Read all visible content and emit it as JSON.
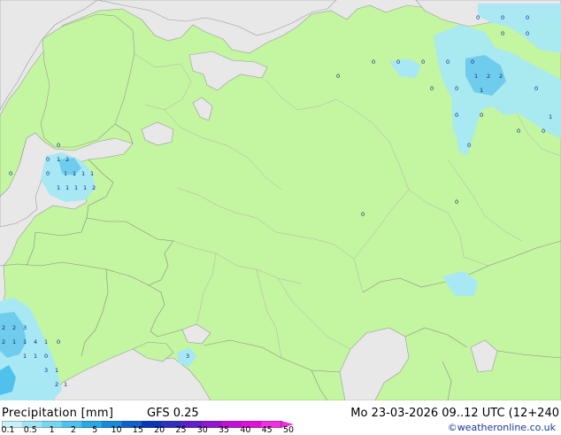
{
  "legend": {
    "title": "Precipitation [mm]",
    "model": "GFS 0.25",
    "valid_time": "Mo 23-03-2026 09..12 UTC (12+240",
    "credit": "©weatheronline.co.uk",
    "scale_labels": [
      "0.1",
      "0.5",
      "1",
      "2",
      "5",
      "10",
      "15",
      "20",
      "25",
      "30",
      "35",
      "40",
      "45",
      "50"
    ],
    "scale_colors": [
      "#c8f0f8",
      "#a0e4f4",
      "#78d4f0",
      "#50c0ec",
      "#28a8e4",
      "#1888d8",
      "#1060c8",
      "#0838b8",
      "#3030c0",
      "#6020c8",
      "#9018d0",
      "#c010d8",
      "#e010d8",
      "#f030e0"
    ]
  },
  "colors": {
    "land": "#c4f5a0",
    "water": "#e8e8e8",
    "border": "#a0a0a0",
    "rain_light": "#a8e8f4",
    "rain_moderate": "#70ccec"
  },
  "map_values": [
    "0",
    "0",
    "0",
    "0",
    "0",
    "0",
    "0",
    "0",
    "0",
    "0",
    "0",
    "0",
    "0",
    "0",
    "0",
    "0",
    "0",
    "0",
    "0",
    "0",
    "1",
    "2",
    "2",
    "1",
    "1",
    "1",
    "1",
    "1",
    "1",
    "0",
    "0",
    "1",
    "2",
    "0",
    "1",
    "1",
    "1",
    "1",
    "2",
    "2",
    "2",
    "0",
    "0",
    "2",
    "1",
    "1",
    "3",
    "4",
    "1",
    "0",
    "1",
    "1",
    "0",
    "3",
    "1",
    "2",
    "1",
    "3"
  ]
}
